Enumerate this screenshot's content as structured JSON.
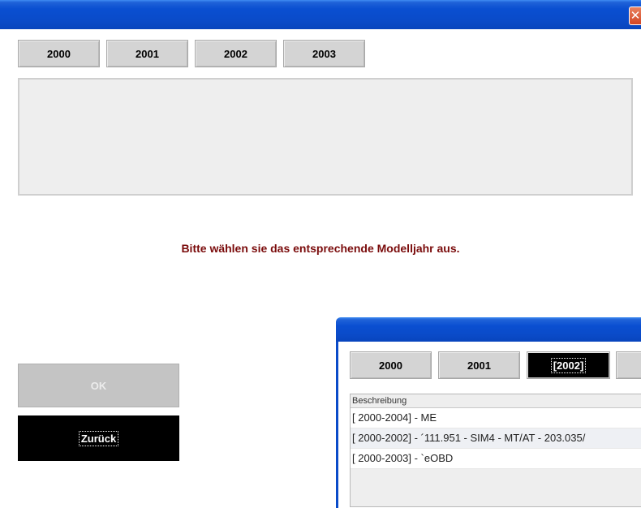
{
  "main_window": {
    "close_glyph": "✕",
    "year_tabs": [
      "2000",
      "2001",
      "2002",
      "2003"
    ],
    "message": "Bitte wählen sie das entsprechende Modelljahr aus.",
    "ok_label": "OK",
    "back_label": "Zurück"
  },
  "sub_window": {
    "year_tabs": [
      "2000",
      "2001",
      "[2002]"
    ],
    "list": {
      "column_header": "Beschreibung",
      "rows": [
        "[ 2000-2004] - ME",
        "[ 2000-2002] - ´111.951 - SIM4 - MT/AT - 203.035/",
        "[ 2000-2003] - `eOBD"
      ]
    }
  },
  "colors": {
    "titlebar": "#0a4bc9",
    "message_text": "#7a0b0b",
    "button_face": "#d4d4d4",
    "selected_button": "#000000"
  }
}
